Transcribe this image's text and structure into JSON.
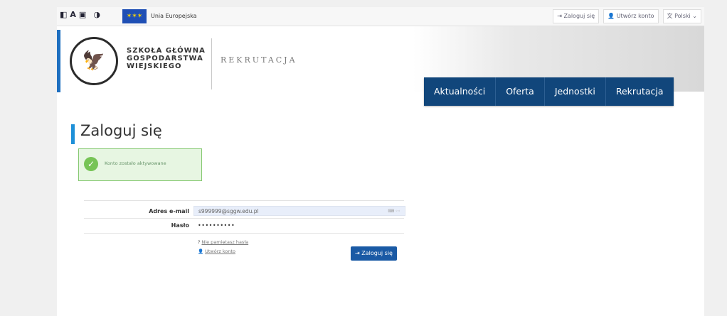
{
  "topbar": {
    "a11y_icons": [
      "contrast-high-icon",
      "font-size-icon",
      "grid-icon",
      "contrast-toggle-icon"
    ],
    "eu_label": "Unia Europejska",
    "login_link": "Zaloguj się",
    "create_account": "Utwórz konto",
    "language": "Polski"
  },
  "brand": {
    "school_line1": "SZKOŁA GŁÓWNA",
    "school_line2": "GOSPODARSTWA",
    "school_line3": "WIEJSKIEGO",
    "section": "REKRUTACJA"
  },
  "nav": {
    "items": [
      "Aktualności",
      "Oferta",
      "Jednostki",
      "Rekrutacja"
    ]
  },
  "page": {
    "title": "Zaloguj się",
    "alert": "Konto zostało aktywowane"
  },
  "form": {
    "email_label": "Adres e-mail",
    "email_value": "s999999@sggw.edu.pl",
    "password_label": "Hasło",
    "password_value": "••••••••••",
    "forgot_password": "Nie pamiętasz hasła",
    "create_account": "Utwórz konto",
    "submit": "Zaloguj się"
  },
  "colors": {
    "nav_bg": "#11467b",
    "accent_blue": "#1e90d8",
    "alert_bg": "#e7f6e2",
    "alert_border": "#85c870",
    "button_bg": "#1a5aa5"
  }
}
